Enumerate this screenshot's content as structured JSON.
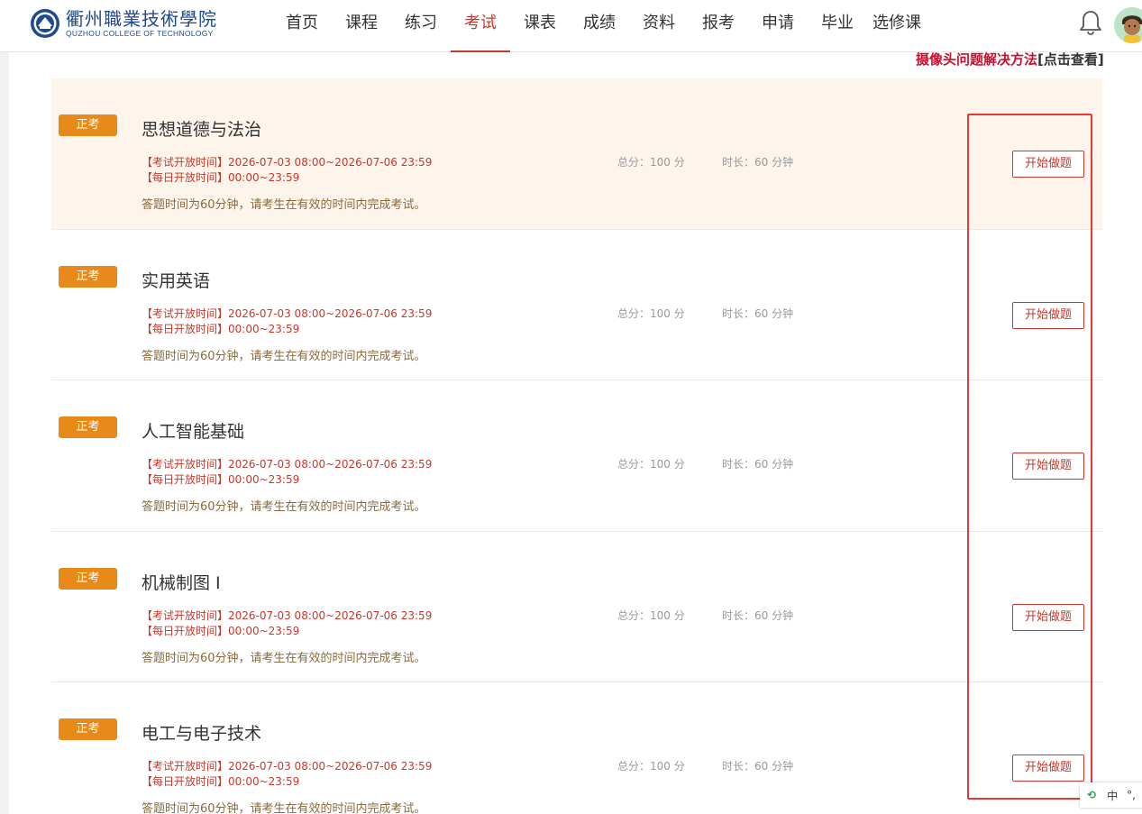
{
  "header": {
    "logo_cn": "衢州職業技術學院",
    "logo_en": "QUZHOU COLLEGE OF TECHNOLOGY",
    "nav": [
      "首页",
      "课程",
      "练习",
      "考试",
      "课表",
      "成绩",
      "资料",
      "报考",
      "申请",
      "毕业",
      "选修课"
    ],
    "active_nav": "考试"
  },
  "notice": {
    "link_text": "摄像头问题解决方法",
    "suffix": "[点击查看]"
  },
  "exams": [
    {
      "badge": "正考",
      "title": "思想道德与法治",
      "open_time": "【考试开放时间】2026-07-03 08:00~2026-07-06 23:59",
      "daily_time": "【每日开放时间】00:00~23:59",
      "total_score": "总分：100 分",
      "duration": "时长：60 分钟",
      "description": "答题时间为60分钟，请考生在有效的时间内完成考试。",
      "button": "开始做题"
    },
    {
      "badge": "正考",
      "title": "实用英语",
      "open_time": "【考试开放时间】2026-07-03 08:00~2026-07-06 23:59",
      "daily_time": "【每日开放时间】00:00~23:59",
      "total_score": "总分：100 分",
      "duration": "时长：60 分钟",
      "description": "答题时间为60分钟，请考生在有效的时间内完成考试。",
      "button": "开始做题"
    },
    {
      "badge": "正考",
      "title": "人工智能基础",
      "open_time": "【考试开放时间】2026-07-03 08:00~2026-07-06 23:59",
      "daily_time": "【每日开放时间】00:00~23:59",
      "total_score": "总分：100 分",
      "duration": "时长：60 分钟",
      "description": "答题时间为60分钟，请考生在有效的时间内完成考试。",
      "button": "开始做题"
    },
    {
      "badge": "正考",
      "title": "机械制图 I",
      "open_time": "【考试开放时间】2026-07-03 08:00~2026-07-06 23:59",
      "daily_time": "【每日开放时间】00:00~23:59",
      "total_score": "总分：100 分",
      "duration": "时长：60 分钟",
      "description": "答题时间为60分钟，请考生在有效的时间内完成考试。",
      "button": "开始做题"
    },
    {
      "badge": "正考",
      "title": "电工与电子技术",
      "open_time": "【考试开放时间】2026-07-03 08:00~2026-07-06 23:59",
      "daily_time": "【每日开放时间】00:00~23:59",
      "total_score": "总分：100 分",
      "duration": "时长：60 分钟",
      "description": "答题时间为60分钟，请考生在有效的时间内完成考试。",
      "button": "开始做题"
    }
  ],
  "ime": {
    "lang": "中",
    "punct": "°,"
  },
  "colors": {
    "accent": "#c8382c",
    "badge": "#e88a1a",
    "highlight_box": "#e53935",
    "first_card_bg": "#fdf4ec",
    "logo_blue": "#1e4a8f"
  },
  "icons": [
    "college-emblem-icon",
    "bell-icon",
    "user-avatar-icon",
    "ime-icon"
  ]
}
